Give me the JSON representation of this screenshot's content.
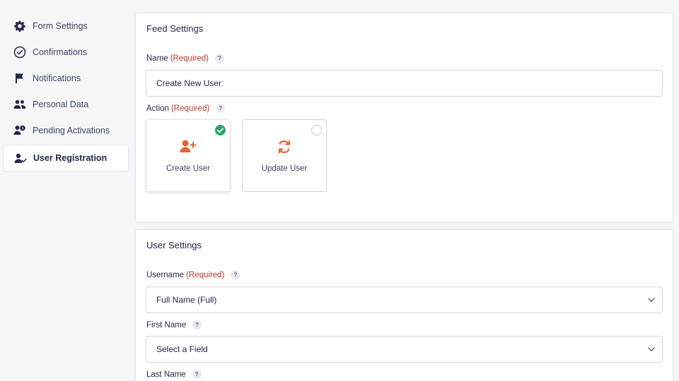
{
  "sidebar": {
    "items": [
      {
        "label": "Form Settings",
        "icon": "gear-icon"
      },
      {
        "label": "Confirmations",
        "icon": "check-circle-icon"
      },
      {
        "label": "Notifications",
        "icon": "flag-icon"
      },
      {
        "label": "Personal Data",
        "icon": "people-icon"
      },
      {
        "label": "Pending Activations",
        "icon": "user-clock-icon"
      },
      {
        "label": "User Registration",
        "icon": "user-check-icon",
        "active": true
      }
    ]
  },
  "feed_settings": {
    "title": "Feed Settings",
    "name_label": "Name",
    "name_required": "(Required)",
    "help": "?",
    "name_value": "Create New User",
    "action_label": "Action",
    "action_required": "(Required)",
    "choices": [
      {
        "label": "Create User",
        "icon": "user-plus-icon",
        "selected": true
      },
      {
        "label": "Update User",
        "icon": "sync-icon",
        "selected": false
      }
    ]
  },
  "user_settings": {
    "title": "User Settings",
    "username_label": "Username",
    "username_required": "(Required)",
    "username_value": "Full Name (Full)",
    "first_name_label": "First Name",
    "first_name_value": "Select a Field",
    "last_name_label": "Last Name"
  },
  "colors": {
    "accent_orange": "#e4643a",
    "required_red": "#c0392b",
    "check_green": "#2aa36b"
  }
}
